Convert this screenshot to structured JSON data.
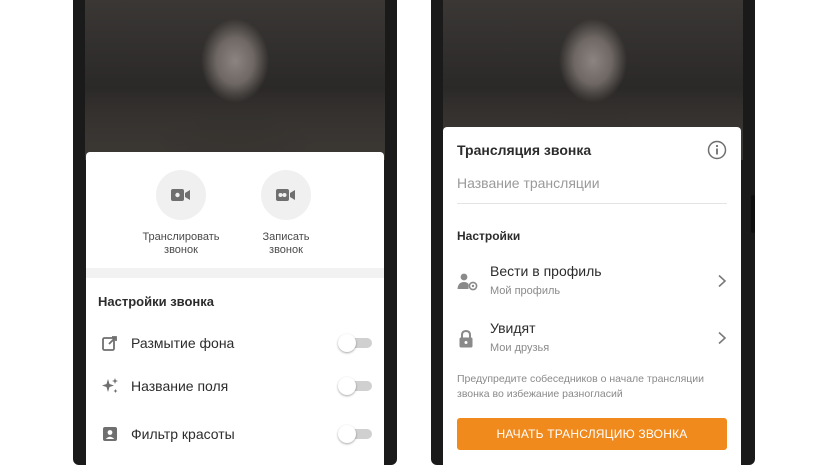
{
  "left_screen": {
    "actions": [
      {
        "label": "Транслировать\nзвонок",
        "icon": "video-camera-icon"
      },
      {
        "label": "Записать\nзвонок",
        "icon": "record-icon"
      }
    ],
    "settings_title": "Настройки звонка",
    "options": [
      {
        "label": "Размытие фона",
        "icon": "share-edit-icon",
        "enabled": false
      },
      {
        "label": "Название поля",
        "icon": "sparkles-icon",
        "enabled": false
      },
      {
        "label": "Фильтр красоты",
        "icon": "portrait-icon",
        "enabled": false
      }
    ]
  },
  "right_screen": {
    "title": "Трансляция звонка",
    "name_placeholder": "Название трансляции",
    "settings_title": "Настройки",
    "rows": [
      {
        "title": "Вести в профиль",
        "subtitle": "Мой профиль",
        "icon": "user-settings-icon"
      },
      {
        "title": "Увидят",
        "subtitle": "Мои друзья",
        "icon": "lock-icon"
      }
    ],
    "note": "Предупредите собеседников о начале трансляции звонка во избежание разногласий",
    "start_button": "НАЧАТЬ ТРАНСЛЯЦИЮ ЗВОНКА",
    "accent_color": "#f08a1c"
  }
}
